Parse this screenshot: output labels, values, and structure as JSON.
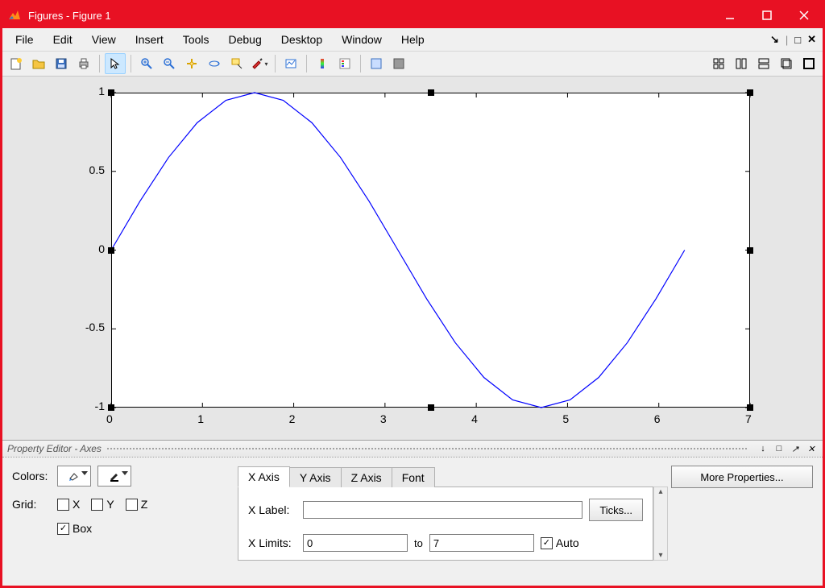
{
  "window": {
    "title": "Figures - Figure 1"
  },
  "menu": {
    "items": [
      "File",
      "Edit",
      "View",
      "Insert",
      "Tools",
      "Debug",
      "Desktop",
      "Window",
      "Help"
    ]
  },
  "chart_data": {
    "type": "line",
    "title": "",
    "xlabel": "",
    "ylabel": "",
    "xlim": [
      0,
      7
    ],
    "ylim": [
      -1,
      1
    ],
    "xticks": [
      0,
      1,
      2,
      3,
      4,
      5,
      6,
      7
    ],
    "yticks": [
      -1,
      -0.5,
      0,
      0.5,
      1
    ],
    "grid": false,
    "box": true,
    "x": [
      0,
      0.314,
      0.628,
      0.942,
      1.257,
      1.571,
      1.885,
      2.199,
      2.513,
      2.827,
      3.142,
      3.456,
      3.77,
      4.084,
      4.398,
      4.712,
      5.027,
      5.341,
      5.655,
      5.969,
      6.283
    ],
    "y": [
      0,
      0.309,
      0.588,
      0.809,
      0.951,
      1.0,
      0.951,
      0.809,
      0.588,
      0.309,
      0.0,
      -0.309,
      -0.588,
      -0.809,
      -0.951,
      -1.0,
      -0.951,
      -0.809,
      -0.588,
      -0.309,
      0.0
    ],
    "series_color": "#0000ff"
  },
  "property_editor": {
    "title": "Property Editor - Axes",
    "colors_label": "Colors:",
    "grid_label": "Grid:",
    "grid_x": "X",
    "grid_y": "Y",
    "grid_z": "Z",
    "box_label": "Box",
    "box_checked": true,
    "tabs": [
      "X Axis",
      "Y Axis",
      "Z Axis",
      "Font"
    ],
    "active_tab": 0,
    "xaxis": {
      "xlabel_caption": "X Label:",
      "xlabel_value": "",
      "ticks_button": "Ticks...",
      "xlimits_caption": "X Limits:",
      "xlim_from": "0",
      "xlim_to_word": "to",
      "xlim_to": "7",
      "auto_label": "Auto",
      "auto_checked": true
    },
    "more_button": "More Properties..."
  }
}
